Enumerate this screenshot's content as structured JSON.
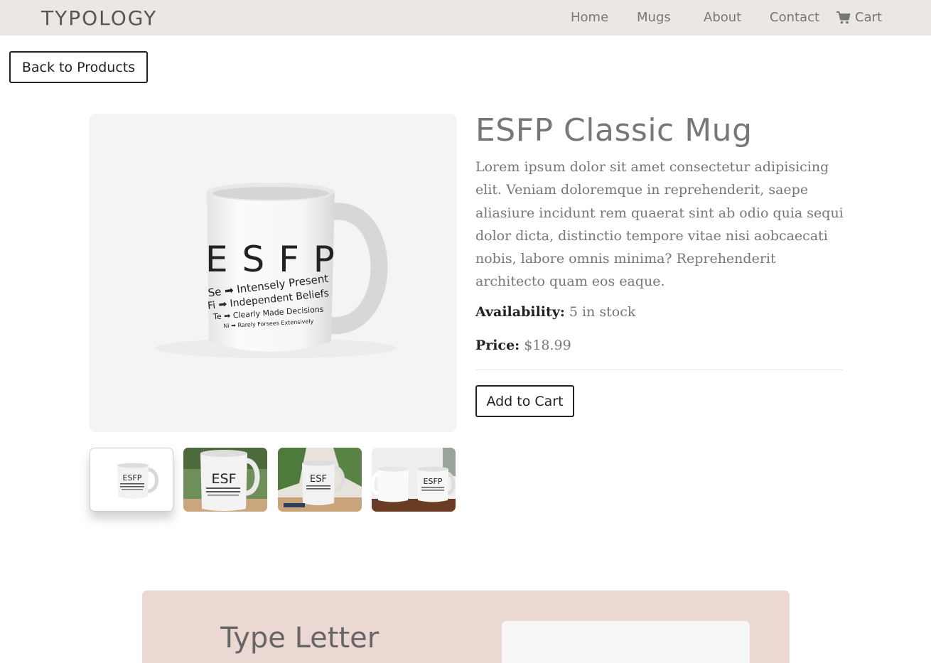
{
  "nav": {
    "brand": "TYPOLOGY",
    "links": [
      "Home",
      "Mugs",
      "About",
      "Contact"
    ],
    "cart_label": "Cart",
    "cart_icon": "shopping-cart-icon"
  },
  "back_button": "Back to Products",
  "product": {
    "title": "ESFP Classic Mug",
    "description": "Lorem ipsum dolor sit amet consectetur adipisicing elit. Veniam doloremque in reprehenderit, saepe aliasiure incidunt rem quaerat sint ab odio quia sequi dolor dicta, distinctio tempore vitae nisi aobcaecati nobis, labore omnis minima? Reprehenderit architecto quam eos eaque.",
    "availability_label": "Availability:",
    "availability_value": "5 in stock",
    "price_label": "Price:",
    "price_value": "$18.99",
    "add_to_cart": "Add to Cart",
    "mug_print": {
      "type": "E S F P",
      "lines": [
        "Se ➡ Intensely Present",
        "Fi ➡ Independent Beliefs",
        "Te ➡ Clearly Made Decisions",
        "Ni ➡ Rarely Forsees Extensively"
      ]
    }
  },
  "letter_section": {
    "title": "Type Letter"
  }
}
